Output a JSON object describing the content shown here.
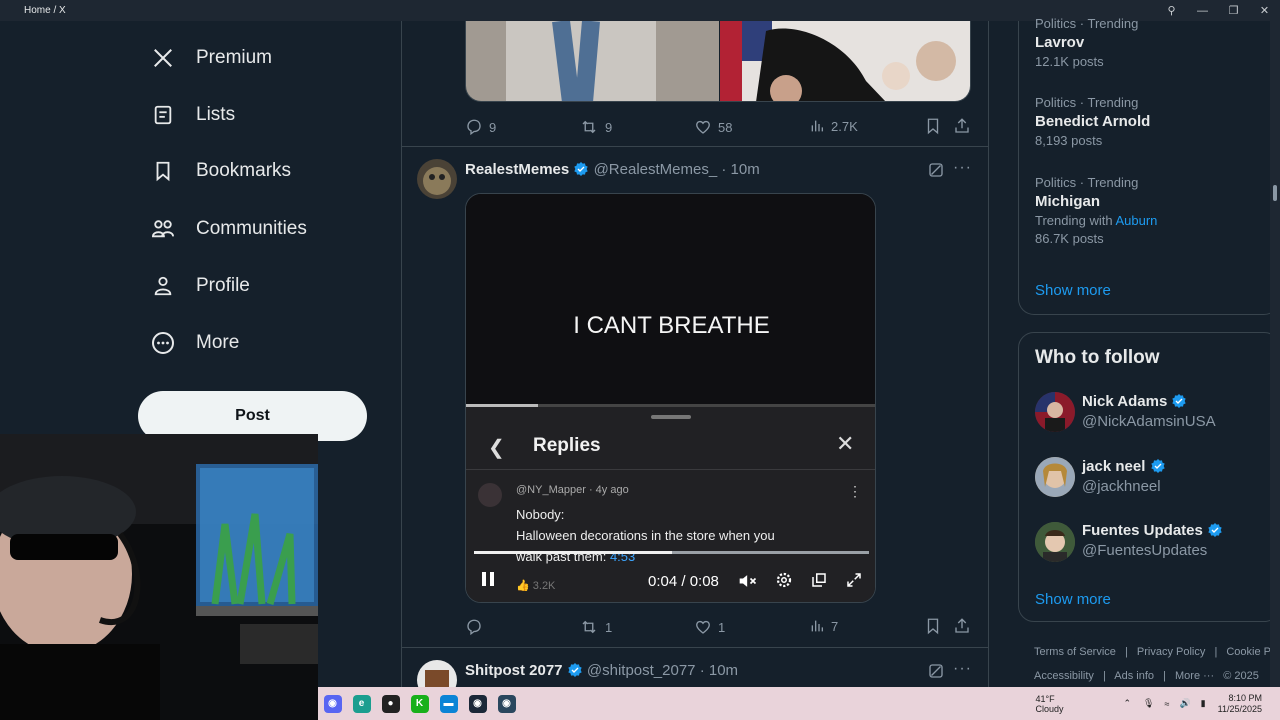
{
  "window": {
    "title": "Home / X"
  },
  "nav": {
    "items": [
      {
        "label": "Premium",
        "icon": "x-logo-icon"
      },
      {
        "label": "Lists",
        "icon": "list-icon"
      },
      {
        "label": "Bookmarks",
        "icon": "bookmark-icon"
      },
      {
        "label": "Communities",
        "icon": "communities-icon"
      },
      {
        "label": "Profile",
        "icon": "profile-icon"
      },
      {
        "label": "More",
        "icon": "more-circle-icon"
      }
    ],
    "post_label": "Post"
  },
  "feed": {
    "top_tweet_actions": {
      "replies": "9",
      "reposts": "9",
      "likes": "58",
      "views": "2.7K"
    },
    "tweet2": {
      "author": "RealestMemes",
      "handle": "@RealestMemes_",
      "time": "· 10m",
      "video": {
        "caption": "I CANT BREATHE",
        "panel_title": "Replies",
        "comment_user": "@NY_Mapper",
        "comment_age": "· 4y ago",
        "comment_line1": "Nobody:",
        "comment_line2": "Halloween decorations in the store when you",
        "comment_line3": "walk past them:",
        "comment_timestamp": "4:53",
        "comment_likes": "3.2K",
        "time_display": "0:04 / 0:08",
        "progress": 0.5
      },
      "actions": {
        "replies": "",
        "reposts": "1",
        "likes": "1",
        "views": "7"
      }
    },
    "tweet3": {
      "author": "Shitpost 2077",
      "handle": "@shitpost_2077",
      "time": "· 10m"
    }
  },
  "trends": [
    {
      "context": "Politics · Trending",
      "name": "Lavrov",
      "count": "12.1K posts"
    },
    {
      "context": "Politics · Trending",
      "name": "Benedict Arnold",
      "count": "8,193 posts"
    },
    {
      "context": "Politics · Trending",
      "name": "Michigan",
      "with_label": "Trending with",
      "with_link": "Auburn",
      "count": "86.7K posts"
    }
  ],
  "trends_show_more": "Show more",
  "who_to_follow": {
    "title": "Who to follow",
    "users": [
      {
        "name": "Nick Adams",
        "handle": "@NickAdamsinUSA"
      },
      {
        "name": "jack neel",
        "handle": "@jackhneel"
      },
      {
        "name": "Fuentes Updates",
        "handle": "@FuentesUpdates"
      }
    ],
    "show_more": "Show more"
  },
  "footer": {
    "links": [
      "Terms of Service",
      "|",
      "Privacy Policy",
      "|",
      "Cookie P"
    ],
    "links2": [
      "Accessibility",
      "|",
      "Ads info",
      "|",
      "More ···",
      "© 2025"
    ]
  },
  "taskbar": {
    "weather_temp": "41°F",
    "weather_cond": "Cloudy",
    "clock_time": "8:10 PM",
    "clock_date": "11/25/2025"
  },
  "colors": {
    "accent": "#1d9bf0",
    "bg": "#15202b",
    "verified": "#1d9bf0"
  }
}
